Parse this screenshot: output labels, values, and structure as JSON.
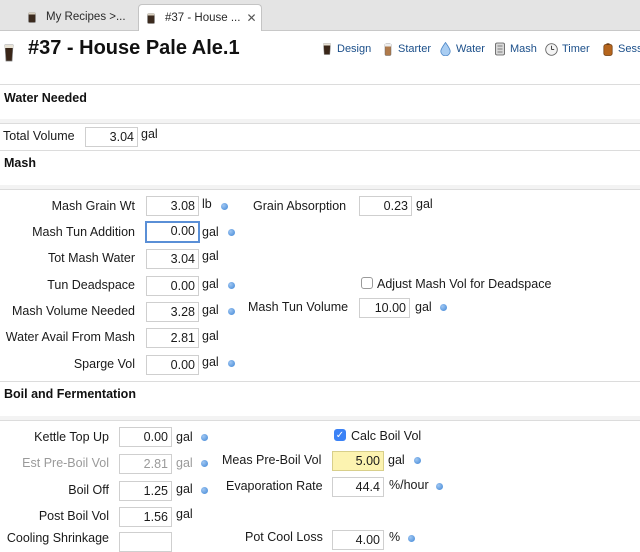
{
  "tabs": [
    {
      "label": "My Recipes >..."
    },
    {
      "label": "#37 - House ...",
      "close": "✕"
    }
  ],
  "header": {
    "title": "#37 - House Pale Ale.1",
    "toolbar": [
      {
        "label": "Design",
        "icon": "beer-glass-icon"
      },
      {
        "label": "Starter",
        "icon": "starter-flask-icon"
      },
      {
        "label": "Water",
        "icon": "water-drop-icon"
      },
      {
        "label": "Mash",
        "icon": "mash-tun-icon"
      },
      {
        "label": "Timer",
        "icon": "timer-clock-icon"
      },
      {
        "label": "Sess",
        "icon": "session-keg-icon"
      }
    ]
  },
  "water_needed": {
    "title": "Water Needed",
    "total_volume": {
      "label": "Total Volume",
      "value": "3.04",
      "unit": "gal"
    }
  },
  "mash": {
    "title": "Mash",
    "grain_wt": {
      "label": "Mash Grain Wt",
      "value": "3.08",
      "unit": "lb"
    },
    "grain_absorption": {
      "label": "Grain Absorption",
      "value": "0.23",
      "unit": "gal"
    },
    "tun_addition": {
      "label": "Mash Tun Addition",
      "value": "0.00",
      "unit": "gal"
    },
    "tot_mash_water": {
      "label": "Tot Mash Water",
      "value": "3.04",
      "unit": "gal"
    },
    "tun_deadspace": {
      "label": "Tun Deadspace",
      "value": "0.00",
      "unit": "gal"
    },
    "adjust_deadspace": {
      "label": "Adjust Mash Vol for Deadspace",
      "checked": false
    },
    "volume_needed": {
      "label": "Mash Volume Needed",
      "value": "3.28",
      "unit": "gal"
    },
    "tun_volume": {
      "label": "Mash Tun Volume",
      "value": "10.00",
      "unit": "gal"
    },
    "water_avail": {
      "label": "Water Avail From Mash",
      "value": "2.81",
      "unit": "gal"
    },
    "sparge_vol": {
      "label": "Sparge Vol",
      "value": "0.00",
      "unit": "gal"
    }
  },
  "boil": {
    "title": "Boil and Fermentation",
    "kettle_top_up": {
      "label": "Kettle Top Up",
      "value": "0.00",
      "unit": "gal"
    },
    "calc_boil_vol": {
      "label": "Calc Boil Vol",
      "checked": true
    },
    "est_pre_boil": {
      "label": "Est Pre-Boil Vol",
      "value": "2.81",
      "unit": "gal"
    },
    "meas_pre_boil": {
      "label": "Meas Pre-Boil Vol",
      "value": "5.00",
      "unit": "gal"
    },
    "boil_off": {
      "label": "Boil Off",
      "value": "1.25",
      "unit": "gal"
    },
    "evap_rate": {
      "label": "Evaporation Rate",
      "value": "44.4",
      "unit": "%/hour"
    },
    "post_boil": {
      "label": "Post Boil Vol",
      "value": "1.56",
      "unit": "gal"
    },
    "cooling_shrinkage": {
      "label": "Cooling Shrinkage"
    },
    "pot_cool_loss": {
      "label": "Pot Cool Loss",
      "value": "4.00",
      "unit": "%"
    }
  }
}
